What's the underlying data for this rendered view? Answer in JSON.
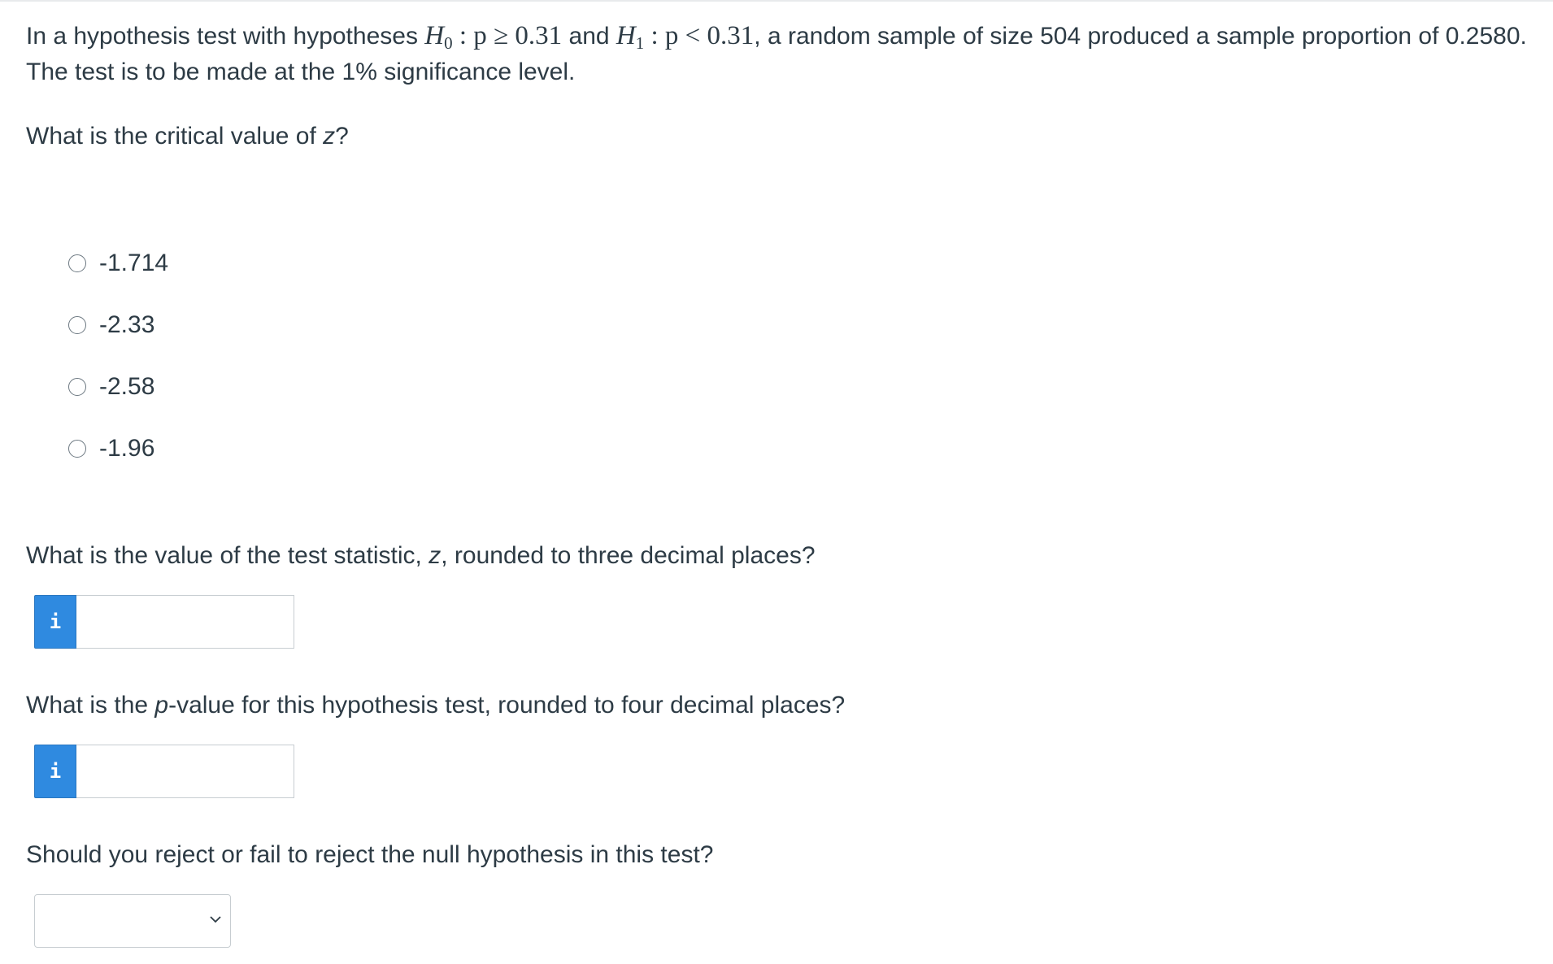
{
  "intro": {
    "part1": "In a hypothesis test with hypotheses ",
    "h0_label": "H",
    "h0_sub": "0",
    "h0_rel": " : p ≥ 0.31",
    "and": " and ",
    "h1_label": "H",
    "h1_sub": "1",
    "h1_rel": " : p < 0.31",
    "part2": ", a random sample of size 504 produced a sample proportion of 0.2580. The test is to be made at the 1% significance level."
  },
  "q1": {
    "prompt_before": "What is the critical value of ",
    "prompt_var": "z",
    "prompt_after": "?",
    "options": [
      "-1.714",
      "-2.33",
      "-2.58",
      "-1.96"
    ]
  },
  "q2": {
    "prompt_before": "What is the value of the test statistic, ",
    "prompt_var": "z",
    "prompt_after": ", rounded to three decimal places?",
    "info_icon": "i",
    "value": ""
  },
  "q3": {
    "prompt_before": "What is the ",
    "prompt_var": "p",
    "prompt_after": "-value for this hypothesis test, rounded to four decimal places?",
    "info_icon": "i",
    "value": ""
  },
  "q4": {
    "prompt": "Should you reject or fail to reject the null hypothesis in this test?",
    "selected": ""
  }
}
